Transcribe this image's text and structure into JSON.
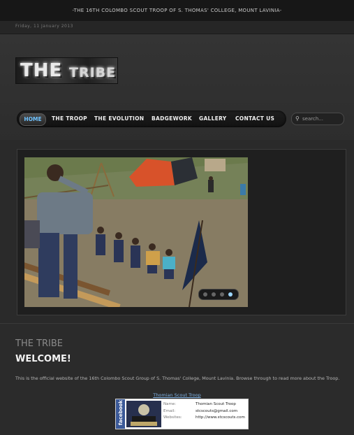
{
  "topbar": {
    "title": "-THE 16TH COLOMBO SCOUT TROOP OF S. THOMAS' COLLEGE, MOUNT LAVINIA-"
  },
  "datebar": {
    "date": "Friday, 11 January 2013"
  },
  "logo": {
    "line1": "THE",
    "line2": "TRIBE"
  },
  "nav": {
    "items": [
      "HOME",
      "THE TROOP",
      "THE EVOLUTION",
      "BADGEWORK",
      "GALLERY",
      "CONTACT US"
    ],
    "active": "HOME"
  },
  "search": {
    "placeholder": "search..."
  },
  "slider": {
    "active_index": 3,
    "dot_count": 4
  },
  "content": {
    "section": "THE TRIBE",
    "heading": "WELCOME!",
    "intro": "This is the official website of the 16th Colombo Scout Group of S. Thomas' College, Mount Lavinia. Browse through to read more about the Troop."
  },
  "facebook": {
    "link_text": "Thomian Scout Troop",
    "side_label": "facebook",
    "rows": [
      {
        "label": "Name:",
        "value": "Thomian Scout Troop"
      },
      {
        "label": "Email:",
        "value": "stcscouts@gmail.com"
      },
      {
        "label": "Websites:",
        "value": "http://www.stcscouts.com"
      }
    ]
  },
  "colors": {
    "accent": "#6fc3ff",
    "background": "#2a2a2a",
    "facebook": "#3b5998"
  }
}
